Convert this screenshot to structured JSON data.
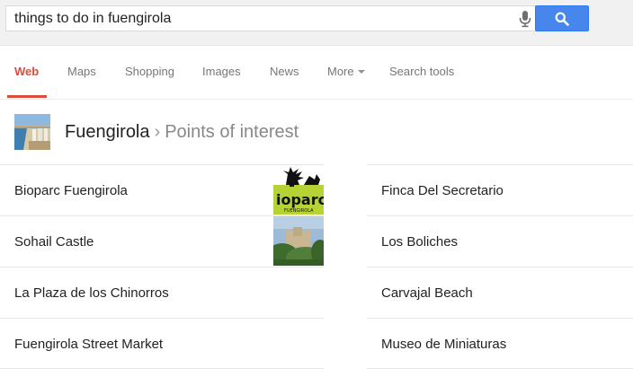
{
  "search": {
    "query": "things to do in fuengirola"
  },
  "tabs": [
    {
      "label": "Web",
      "active": true
    },
    {
      "label": "Maps"
    },
    {
      "label": "Shopping"
    },
    {
      "label": "Images"
    },
    {
      "label": "News"
    },
    {
      "label": "More"
    },
    {
      "label": "Search tools"
    }
  ],
  "knowledge_panel": {
    "title": "Fuengirola",
    "separator": "›",
    "subtitle": "Points of interest"
  },
  "left_items": [
    {
      "label": "Bioparc Fuengirola",
      "logo_text": "ioparc",
      "logo_subtext": "FUENGIROLA"
    },
    {
      "label": "Sohail Castle"
    },
    {
      "label": "La Plaza de los Chinorros"
    },
    {
      "label": "Fuengirola Street Market"
    }
  ],
  "right_items": [
    {
      "label": "Finca Del Secretario"
    },
    {
      "label": "Los Boliches"
    },
    {
      "label": "Carvajal Beach"
    },
    {
      "label": "Museo de Miniaturas"
    }
  ],
  "colors": {
    "accent_red": "#dd4b39",
    "search_blue": "#4787ed",
    "logo_green": "#b5d334"
  }
}
